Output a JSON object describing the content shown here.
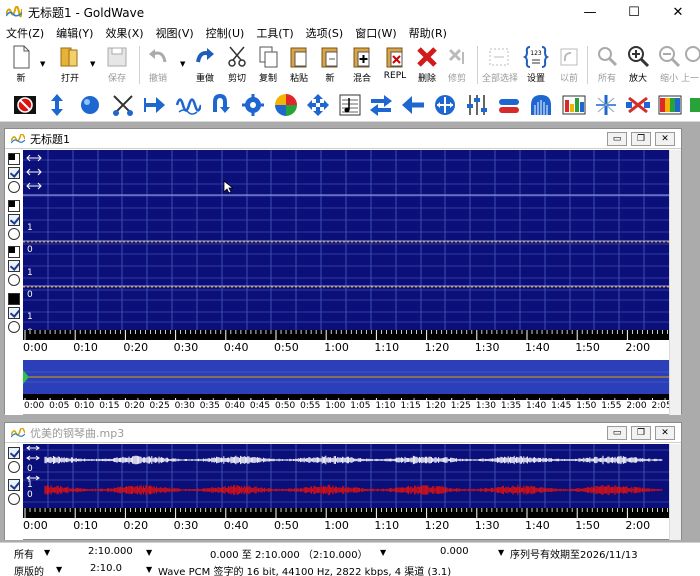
{
  "window": {
    "title": "无标题1 - GoldWave",
    "minimize": "—",
    "maximize": "☐",
    "close": "✕"
  },
  "menu": [
    "文件(Z)",
    "编辑(Y)",
    "效果(X)",
    "视图(V)",
    "控制(U)",
    "工具(T)",
    "选项(S)",
    "窗口(W)",
    "帮助(R)"
  ],
  "toolbar": {
    "new": "新",
    "open": "打开",
    "save": "保存",
    "undo": "撤销",
    "redo": "重做",
    "cut": "剪切",
    "copy": "复制",
    "paste": "粘贴",
    "new_paste": "新",
    "mix": "混合",
    "repl": "REPL",
    "delete": "删除",
    "trim": "修剪",
    "select_all": "全部选择",
    "set": "设置",
    "previous": "以前",
    "all": "所有",
    "zoom_in": "放大",
    "zoom_out": "缩小",
    "prev_page": "上一"
  },
  "track1": {
    "title": "无标题1",
    "channel_scale_1": "1",
    "channel_zero_1": "0",
    "channel_scale_2": "1",
    "channel_zero_2": "0",
    "channel_scale_3": "1",
    "channel_zero_3": "0",
    "time_labels": [
      "0:00",
      "0:10",
      "0:20",
      "0:30",
      "0:40",
      "0:50",
      "1:00",
      "1:10",
      "1:20",
      "1:30",
      "1:40",
      "1:50",
      "2:00"
    ],
    "overview_labels": [
      "0:00",
      "0:05",
      "0:10",
      "0:15",
      "0:20",
      "0:25",
      "0:30",
      "0:35",
      "0:40",
      "0:45",
      "0:50",
      "0:55",
      "1:00",
      "1:05",
      "1:10",
      "1:15",
      "1:20",
      "1:25",
      "1:30",
      "1:35",
      "1:40",
      "1:45",
      "1:50",
      "1:55",
      "2:00",
      "2:05"
    ]
  },
  "track2": {
    "title": "优美的钢琴曲.mp3",
    "channel_zero_1": "0",
    "channel_scale_2": "1",
    "channel_zero_2": "0",
    "time_labels": [
      "0:00",
      "0:10",
      "0:20",
      "0:30",
      "0:40",
      "0:50",
      "1:00",
      "1:10",
      "1:20",
      "1:30",
      "1:40",
      "1:50",
      "2:00"
    ]
  },
  "status": {
    "r1_c1": "所有",
    "r1_c2": "2:10.000",
    "r1_c3": "0.000 至 2:10.000 （2:10.000）",
    "r1_c4": "0.000",
    "r1_c5": "序列号有效期至2026/11/13",
    "r2_c1": "原版的",
    "r2_c2": "2:10.0",
    "r2_c3": "Wave PCM 签字的 16 bit, 44100 Hz, 2822 kbps, 4 渠道 (3.1)"
  },
  "colors": {
    "wave_bg": "#0b0f7a",
    "grid": "#3e4fae",
    "left_channel": "#ffffff",
    "right_channel": "#e01010",
    "selection_line": "#f0a000"
  }
}
